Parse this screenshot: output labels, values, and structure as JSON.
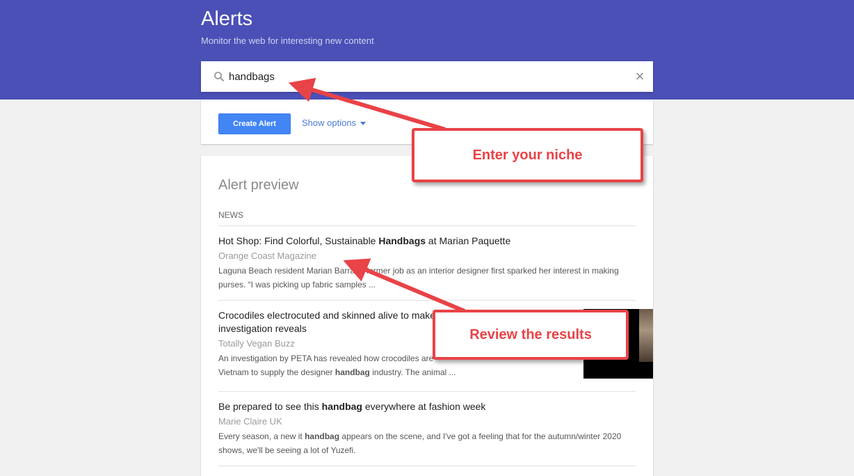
{
  "header": {
    "title": "Alerts",
    "subtitle": "Monitor the web for interesting new content",
    "color": "#4a50b6"
  },
  "search": {
    "value": "handbags",
    "icon": "search-icon",
    "clear_icon": "close-icon"
  },
  "options": {
    "create_label": "Create Alert",
    "show_options_label": "Show options"
  },
  "preview": {
    "title": "Alert preview",
    "section": "NEWS",
    "items": [
      {
        "title_before": "Hot Shop: Find Colorful, Sustainable ",
        "title_bold": "Handbags",
        "title_after": " at Marian Paquette",
        "source": "Orange Coast Magazine",
        "snippet_line1": "Laguna Beach resident Marian Barra, a former job as an interior designer first sparked her interest in making",
        "snippet_line2": "purses. “I was picking up fabric samples ..."
      },
      {
        "title_line1": "Crocodiles electrocuted and skinned alive to make",
        "title_line2": "investigation reveals",
        "source": "Totally Vegan Buzz",
        "snippet_line1": "An investigation by PETA has revealed how crocodiles are",
        "snippet_line2_before": "Vietnam to supply the designer ",
        "snippet_line2_bold": "handbag",
        "snippet_line2_after": " industry. The animal ..."
      },
      {
        "title_before": "Be prepared to see this ",
        "title_bold": "handbag",
        "title_after": " everywhere at fashion week",
        "source": "Marie Claire UK",
        "snippet_line1_before": "Every season, a new it ",
        "snippet_line1_bold": "handbag",
        "snippet_line1_after": " appears on the scene, and I've got a feeling that for the autumn/winter 2020",
        "snippet_line2": "shows, we'll be seeing a lot of Yuzefi."
      }
    ]
  },
  "annotations": {
    "callout1": "Enter your niche",
    "callout2": "Review the results",
    "color": "#e84347"
  }
}
